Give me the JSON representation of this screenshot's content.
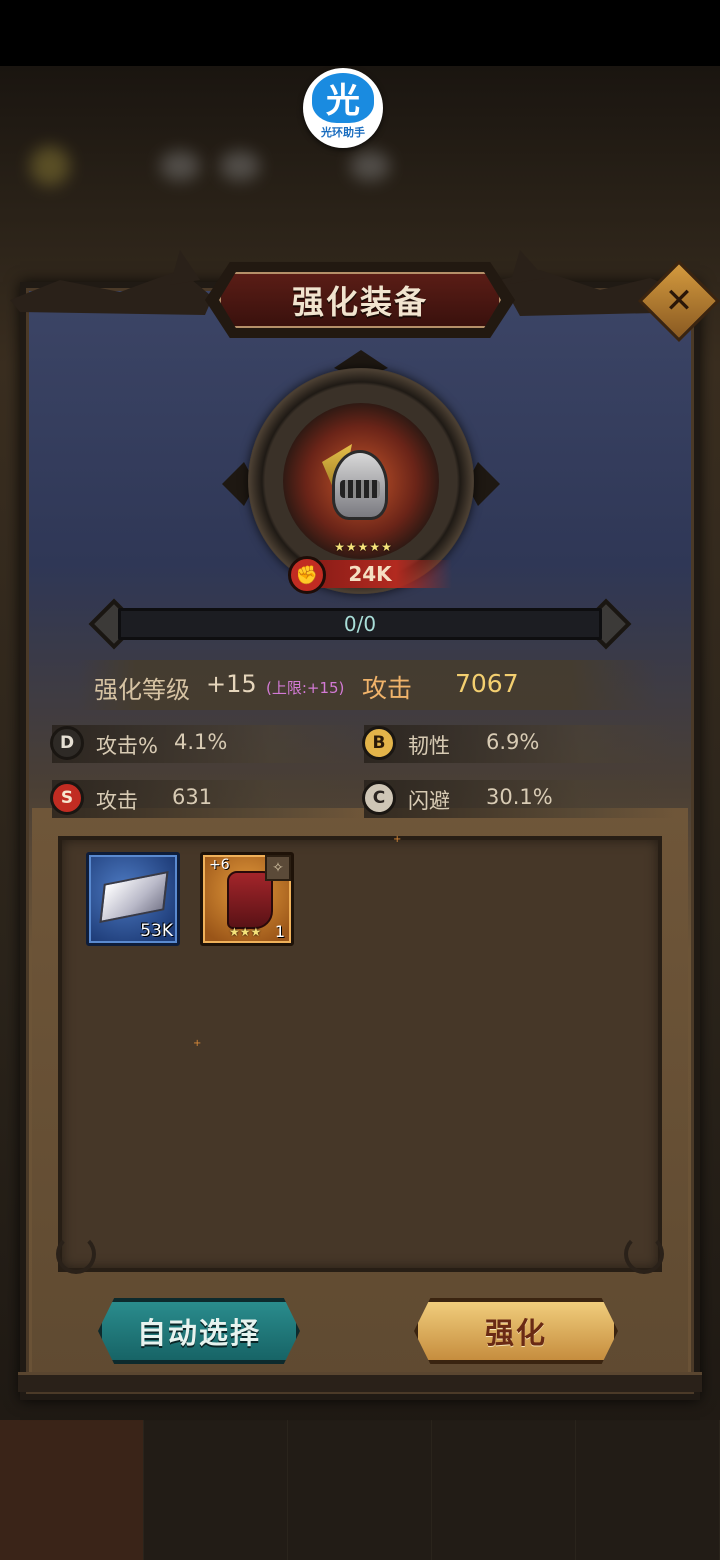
{
  "assistant": {
    "glyph": "光",
    "label": "光环助手"
  },
  "dialog": {
    "title": "强化装备",
    "close_glyph": "✕"
  },
  "equipment": {
    "icon": "helmet-icon",
    "stars": 5,
    "star_glyph": "★",
    "power_icon": "fist-icon",
    "power": "24K"
  },
  "progress": {
    "text": "0/0",
    "fraction": 0
  },
  "level": {
    "label": "强化等级",
    "value": "+15",
    "cap": "(上限:+15)",
    "attack_label": "攻击",
    "attack_value": "7067"
  },
  "stats": [
    {
      "grade": "D",
      "name": "攻击%",
      "value": "4.1%",
      "color": "#2e2a26",
      "text_color": "#e6e0d4"
    },
    {
      "grade": "B",
      "name": "韧性",
      "value": "6.9%",
      "color": "#e3b44a",
      "text_color": "#2a1a08"
    },
    {
      "grade": "S",
      "name": "攻击",
      "value": "631",
      "color": "#c12c22",
      "text_color": "#f7e6d0"
    },
    {
      "grade": "C",
      "name": "闪避",
      "value": "30.1%",
      "color": "#cfc6b6",
      "text_color": "#2a2420"
    }
  ],
  "materials": [
    {
      "type": "ingot",
      "icon": "ingot-icon",
      "count": "53K"
    },
    {
      "type": "boot",
      "icon": "boot-icon",
      "level": "+6",
      "stars": "★★★",
      "count": "1",
      "type_icon": "✧"
    }
  ],
  "buttons": {
    "auto_select": "自动选择",
    "enhance": "强化"
  },
  "colors": {
    "accent_gold": "#f3cf70",
    "cap_purple": "#d37ad5",
    "teal_button": "#2a8c8d",
    "gold_button": "#f0cd7c"
  }
}
